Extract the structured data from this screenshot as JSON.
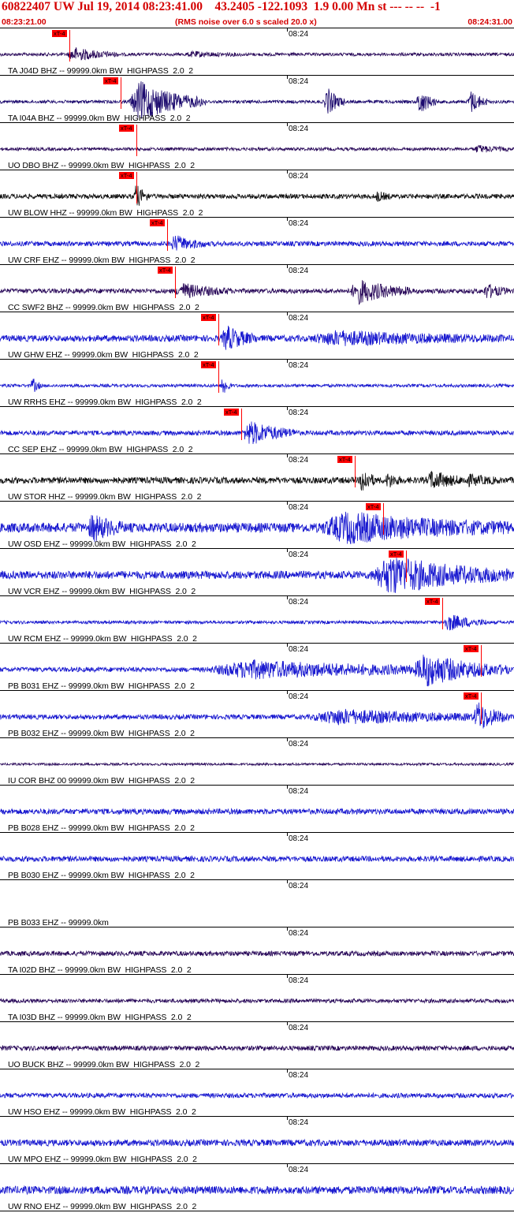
{
  "header": {
    "title": "60822407 UW Jul 19, 2014 08:23:41.00    43.2405 -122.1093  1.9 0.00 Mn st --- -- --  -1",
    "start_time": "08:23:21.00",
    "rms_note": "(RMS noise over 6.0 s scaled 20.0 x)",
    "end_time": "08:24:31.00"
  },
  "time_tick": "08:24",
  "pick_label": "xT-4",
  "colors": {
    "header_text": "#d40000",
    "pick": "#ff0000"
  },
  "traces": [
    {
      "label": "TA J04D BHZ -- 99999.0km BW  HIGHPASS  2.0  2",
      "color": "#2a0a5a",
      "base_amp": 2,
      "pick": 0.135,
      "bursts": [
        [
          0.13,
          0.23,
          8
        ],
        [
          0.36,
          0.47,
          2.5
        ]
      ]
    },
    {
      "label": "TA I04A BHZ -- 99999.0km BW  HIGHPASS  2.0  2",
      "color": "#1c0a6e",
      "base_amp": 2,
      "pick": 0.235,
      "bursts": [
        [
          0.25,
          0.4,
          25
        ],
        [
          0.63,
          0.67,
          18
        ],
        [
          0.81,
          0.85,
          16
        ],
        [
          0.91,
          0.95,
          14
        ]
      ]
    },
    {
      "label": "UO DBO BHZ -- 99999.0km BW  HIGHPASS  2.0  2",
      "color": "#2a0a5a",
      "base_amp": 2,
      "pick": 0.265,
      "bursts": [
        [
          0.92,
          0.99,
          4
        ]
      ]
    },
    {
      "label": "UW BLOW HHZ -- 99999.0km BW  HIGHPASS  2.0  2",
      "color": "#111111",
      "base_amp": 3,
      "pick": 0.265,
      "bursts": [
        [
          0.26,
          0.29,
          14
        ],
        [
          0.73,
          0.76,
          5
        ]
      ]
    },
    {
      "label": "UW CRF EHZ -- 99999.0km BW  HIGHPASS  2.0  2",
      "color": "#1a1ad0",
      "base_amp": 3,
      "pick": 0.325,
      "bursts": [
        [
          0.33,
          0.4,
          9
        ]
      ]
    },
    {
      "label": "CC SWF2 BHZ -- 99999.0km BW  HIGHPASS  2.0  2",
      "color": "#2a0a5a",
      "base_amp": 3,
      "pick": 0.34,
      "bursts": [
        [
          0.34,
          0.45,
          8
        ],
        [
          0.68,
          0.8,
          14
        ],
        [
          0.94,
          0.99,
          8
        ]
      ]
    },
    {
      "label": "UW GHW EHZ -- 99999.0km BW  HIGHPASS  2.0  2",
      "color": "#1a1ad0",
      "base_amp": 4,
      "pick": 0.425,
      "bursts": [
        [
          0.43,
          0.5,
          14
        ],
        [
          0.6,
          0.98,
          7
        ]
      ]
    },
    {
      "label": "UW RRHS EHZ -- 99999.0km BW  HIGHPASS  2.0  2",
      "color": "#1a1ad0",
      "base_amp": 2,
      "pick": 0.425,
      "bursts": [
        [
          0.06,
          0.08,
          10
        ],
        [
          0.43,
          0.45,
          14
        ]
      ]
    },
    {
      "label": "CC SEP EHZ -- 99999.0km BW  HIGHPASS  2.0  2",
      "color": "#1a1ad0",
      "base_amp": 3,
      "pick": 0.47,
      "bursts": [
        [
          0.47,
          0.58,
          14
        ]
      ]
    },
    {
      "label": "UW STOR HHZ -- 99999.0km BW  HIGHPASS  2.0  2",
      "color": "#111111",
      "base_amp": 4,
      "pick": 0.69,
      "bursts": [
        [
          0.7,
          0.73,
          16
        ],
        [
          0.75,
          0.78,
          8
        ],
        [
          0.83,
          0.9,
          10
        ],
        [
          0.9,
          0.97,
          5
        ]
      ]
    },
    {
      "label": "UW OSD EHZ -- 99999.0km BW  HIGHPASS  2.0  2",
      "color": "#1a1ad0",
      "base_amp": 6,
      "pick": 0.745,
      "bursts": [
        [
          0.17,
          0.24,
          14
        ],
        [
          0.62,
          0.99,
          16
        ]
      ]
    },
    {
      "label": "UW VCR EHZ -- 99999.0km BW  HIGHPASS  2.0  2",
      "color": "#1a1ad0",
      "base_amp": 5,
      "pick": 0.79,
      "bursts": [
        [
          0.72,
          0.99,
          22
        ]
      ]
    },
    {
      "label": "UW RCM EHZ -- 99999.0km BW  HIGHPASS  2.0  2",
      "color": "#1a1ad0",
      "base_amp": 2,
      "pick": 0.86,
      "bursts": [
        [
          0.86,
          0.95,
          10
        ]
      ]
    },
    {
      "label": "PB B031 EHZ -- 99999.0km BW  HIGHPASS  2.0  2",
      "color": "#1a1ad0",
      "base_amp": 3,
      "pick": 0.935,
      "bursts": [
        [
          0.4,
          0.99,
          10
        ],
        [
          0.8,
          0.99,
          20
        ]
      ]
    },
    {
      "label": "PB B032 EHZ -- 99999.0km BW  HIGHPASS  2.0  2",
      "color": "#1a1ad0",
      "base_amp": 3,
      "pick": 0.935,
      "bursts": [
        [
          0.6,
          0.99,
          8
        ],
        [
          0.92,
          0.99,
          18
        ]
      ]
    },
    {
      "label": "IU COR BHZ 00 99999.0km BW  HIGHPASS  2.0  2",
      "color": "#2a0a5a",
      "base_amp": 1.5,
      "pick": null,
      "bursts": []
    },
    {
      "label": "PB B028 EHZ -- 99999.0km BW  HIGHPASS  2.0  2",
      "color": "#1a1ad0",
      "base_amp": 3.5,
      "pick": null,
      "bursts": []
    },
    {
      "label": "PB B030 EHZ -- 99999.0km BW  HIGHPASS  2.0  2",
      "color": "#1a1ad0",
      "base_amp": 3.5,
      "pick": null,
      "bursts": []
    },
    {
      "label": "PB B033 EHZ -- 99999.0km",
      "color": "#1a1ad0",
      "base_amp": 0,
      "pick": null,
      "bursts": []
    },
    {
      "label": "TA I02D BHZ -- 99999.0km BW  HIGHPASS  2.0  2",
      "color": "#2a0a5a",
      "base_amp": 3,
      "pick": null,
      "bursts": []
    },
    {
      "label": "TA I03D BHZ -- 99999.0km BW  HIGHPASS  2.0  2",
      "color": "#2a0a5a",
      "base_amp": 2.5,
      "pick": null,
      "bursts": []
    },
    {
      "label": "UO BUCK BHZ -- 99999.0km BW  HIGHPASS  2.0  2",
      "color": "#2a0a5a",
      "base_amp": 3,
      "pick": null,
      "bursts": []
    },
    {
      "label": "UW HSO EHZ -- 99999.0km BW  HIGHPASS  2.0  2",
      "color": "#1a1ad0",
      "base_amp": 3,
      "pick": null,
      "bursts": []
    },
    {
      "label": "UW MPO EHZ -- 99999.0km BW  HIGHPASS  2.0  2",
      "color": "#1a1ad0",
      "base_amp": 4,
      "pick": null,
      "bursts": []
    },
    {
      "label": "UW RNO EHZ -- 99999.0km BW  HIGHPASS  2.0  2",
      "color": "#1a1ad0",
      "base_amp": 5,
      "pick": null,
      "bursts": []
    }
  ]
}
